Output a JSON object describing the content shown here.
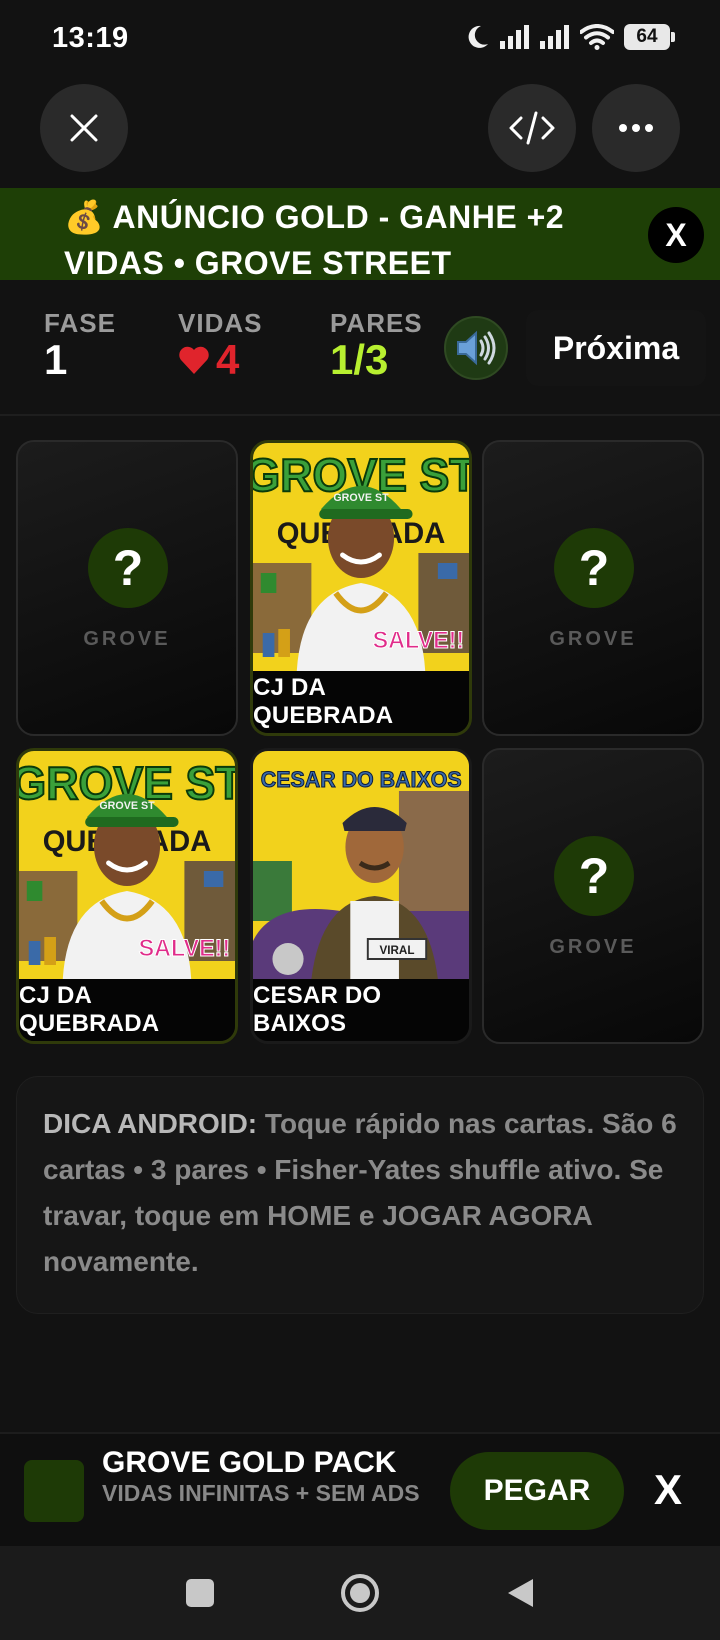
{
  "status_bar": {
    "time": "13:19",
    "battery": "64",
    "icons": [
      "moon-icon",
      "signal-icon",
      "signal-icon",
      "wifi-icon",
      "battery-icon"
    ]
  },
  "top_controls": {
    "close_icon": "close-icon",
    "code_icon": "code-icon",
    "more_icon": "more-icon"
  },
  "banner": {
    "emoji": "💰",
    "text": "ANÚNCIO GOLD - GANHE +2 VIDAS • GROVE STREET",
    "close_label": "X"
  },
  "stats": {
    "phase_label": "FASE",
    "phase_value": "1",
    "lives_label": "VIDAS",
    "lives_value": "4",
    "pairs_label": "PARES",
    "pairs_value": "1/3",
    "next_label": "Próxima"
  },
  "colors": {
    "accent_green": "#1e3a06",
    "banner_green": "#1e3f06",
    "pairs_yellow": "#b8f030",
    "heart_red": "#e0242c",
    "card_yellow": "#f2d21c"
  },
  "cards": [
    {
      "state": "hidden",
      "mark": "?",
      "label": "GROVE"
    },
    {
      "state": "revealed",
      "name": "CJ DA QUEBRADA",
      "art_title": "GROVE ST",
      "art_sub": "QUEBRADA",
      "art_cap": "GROVE ST",
      "art_tag": "SALVE!!"
    },
    {
      "state": "hidden",
      "mark": "?",
      "label": "GROVE"
    },
    {
      "state": "revealed",
      "name": "CJ DA QUEBRADA",
      "art_title": "GROVE ST",
      "art_sub": "QUEBRADA",
      "art_cap": "GROVE ST",
      "art_tag": "SALVE!!"
    },
    {
      "state": "revealed",
      "name": "CESAR DO BAIXOS",
      "art_title": "CESAR DO BAIXOS",
      "art_plate": "VIRAL"
    },
    {
      "state": "hidden",
      "mark": "?",
      "label": "GROVE"
    }
  ],
  "tip": {
    "title": "DICA ANDROID:",
    "body": "Toque rápido nas cartas. São 6 cartas • 3 pares • Fisher-Yates shuffle ativo. Se travar, toque em HOME e JOGAR AGORA novamente."
  },
  "promo": {
    "title": "GROVE GOLD PACK",
    "subtitle": "VIDAS INFINITAS + SEM ADS",
    "button_label": "PEGAR",
    "close_label": "X"
  },
  "navbar": {
    "items": [
      "recents-icon",
      "home-icon",
      "back-icon"
    ]
  }
}
